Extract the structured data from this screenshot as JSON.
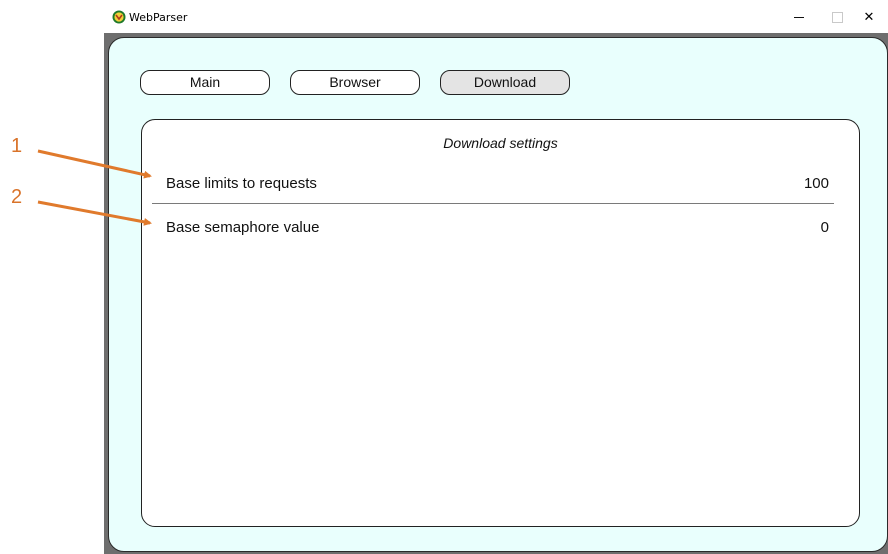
{
  "window": {
    "title": "WebParser",
    "controls": {
      "minimize": "–",
      "maximize": "□",
      "close": "✕"
    }
  },
  "tabs": [
    {
      "label": "Main",
      "active": false
    },
    {
      "label": "Browser",
      "active": false
    },
    {
      "label": "Download",
      "active": true
    }
  ],
  "panel": {
    "title": "Download settings",
    "settings": [
      {
        "label": "Base limits to requests",
        "value": "100"
      },
      {
        "label": "Base semaphore value",
        "value": "0"
      }
    ]
  },
  "annotations": [
    {
      "number": "1",
      "target": "Base limits to requests"
    },
    {
      "number": "2",
      "target": "Base semaphore value"
    }
  ],
  "colors": {
    "client_background": "#e9fffd",
    "annotation": "#d9732a",
    "active_tab": "#e4e4e4"
  },
  "icons": {
    "app": "webparser-app-icon"
  }
}
